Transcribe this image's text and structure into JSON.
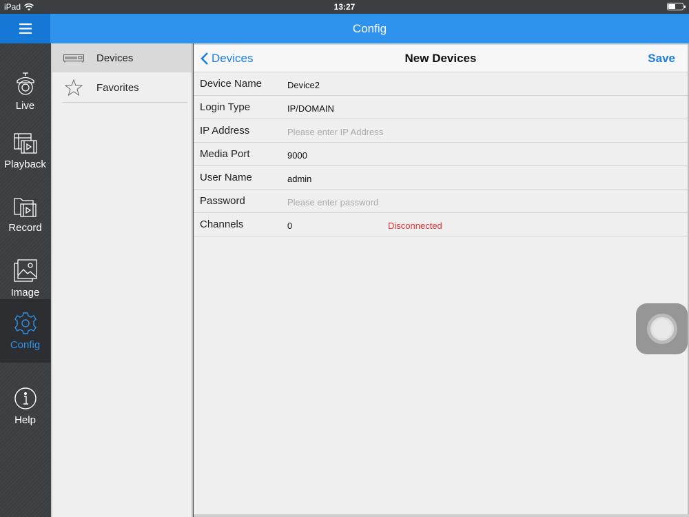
{
  "status_bar": {
    "device": "iPad",
    "time": "13:27",
    "wifi_icon": "wifi-icon",
    "battery_icon": "battery-icon"
  },
  "header": {
    "title": "Config",
    "menu_icon": "hamburger-menu-icon"
  },
  "colors": {
    "header_blue": "#2e93ec",
    "active_blue": "#2e93ec",
    "link_blue": "#1f7ee0",
    "error_red": "#e23030"
  },
  "left_nav": {
    "items": [
      {
        "label": "Live",
        "icon": "camera-icon"
      },
      {
        "label": "Playback",
        "icon": "film-playback-icon"
      },
      {
        "label": "Record",
        "icon": "record-folder-icon"
      },
      {
        "label": "Image",
        "icon": "image-icon"
      },
      {
        "label": "Config",
        "icon": "gear-icon",
        "active": true
      },
      {
        "label": "Help",
        "icon": "info-icon"
      }
    ]
  },
  "middle_list": {
    "items": [
      {
        "label": "Devices",
        "icon": "dvr-device-icon",
        "active": true
      },
      {
        "label": "Favorites",
        "icon": "star-icon"
      }
    ]
  },
  "panel": {
    "back_label": "Devices",
    "title": "New Devices",
    "save_label": "Save",
    "fields": {
      "device_name": {
        "label": "Device Name",
        "value": "Device2"
      },
      "login_type": {
        "label": "Login Type",
        "value": "IP/DOMAIN"
      },
      "ip_address": {
        "label": "IP Address",
        "value": "",
        "placeholder": "Please enter IP Address"
      },
      "media_port": {
        "label": "Media Port",
        "value": "9000"
      },
      "user_name": {
        "label": "User Name",
        "value": "admin"
      },
      "password": {
        "label": "Password",
        "value": "",
        "placeholder": "Please enter password"
      },
      "channels": {
        "label": "Channels",
        "value": "0",
        "status": "Disconnected"
      }
    }
  }
}
